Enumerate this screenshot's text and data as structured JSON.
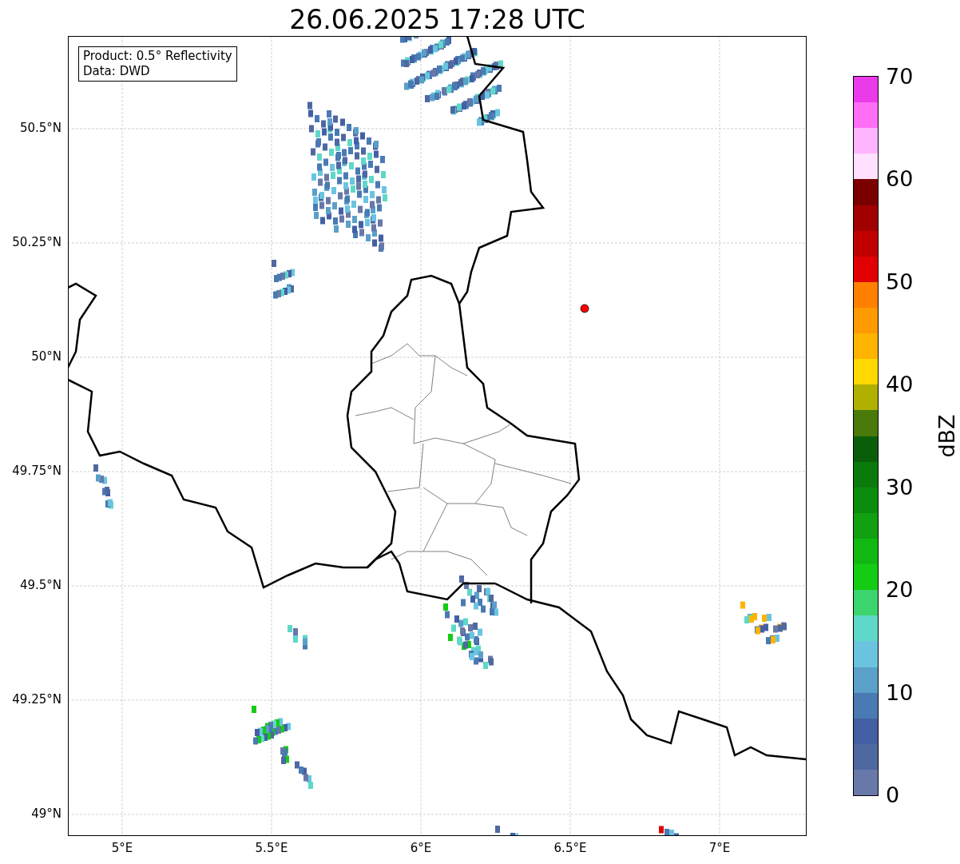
{
  "title": "26.06.2025 17:28 UTC",
  "info_box": [
    "Product: 0.5° Reflectivity",
    "Data: DWD"
  ],
  "lat_ticks": [
    "50.5°N",
    "50.25°N",
    "50°N",
    "49.75°N",
    "49.5°N",
    "49.25°N",
    "49°N"
  ],
  "lon_ticks": [
    "5°E",
    "5.5°E",
    "6°E",
    "6.5°E",
    "7°E"
  ],
  "colorbar": {
    "label": "dBZ",
    "ticks": [
      "70",
      "60",
      "50",
      "40",
      "30",
      "20",
      "10",
      "0"
    ],
    "bins": [
      {
        "color": "#ea3aea"
      },
      {
        "color": "#ff6ef5"
      },
      {
        "color": "#ffb4ff"
      },
      {
        "color": "#ffe0ff"
      },
      {
        "color": "#7a0000"
      },
      {
        "color": "#a00000"
      },
      {
        "color": "#c00000"
      },
      {
        "color": "#e00000"
      },
      {
        "color": "#ff7f00"
      },
      {
        "color": "#ff9a00"
      },
      {
        "color": "#ffb400"
      },
      {
        "color": "#ffd800"
      },
      {
        "color": "#b0b000"
      },
      {
        "color": "#4a7a0a"
      },
      {
        "color": "#0a5e0a"
      },
      {
        "color": "#0a7a0a"
      },
      {
        "color": "#0c8c0c"
      },
      {
        "color": "#10a010"
      },
      {
        "color": "#12b812"
      },
      {
        "color": "#14cc14"
      },
      {
        "color": "#3cd46c"
      },
      {
        "color": "#5ed8c8"
      },
      {
        "color": "#6ac4e0"
      },
      {
        "color": "#5aa0c8"
      },
      {
        "color": "#4a7ab4"
      },
      {
        "color": "#4460a4"
      },
      {
        "color": "#5068a0"
      },
      {
        "color": "#6878a8"
      }
    ]
  }
}
